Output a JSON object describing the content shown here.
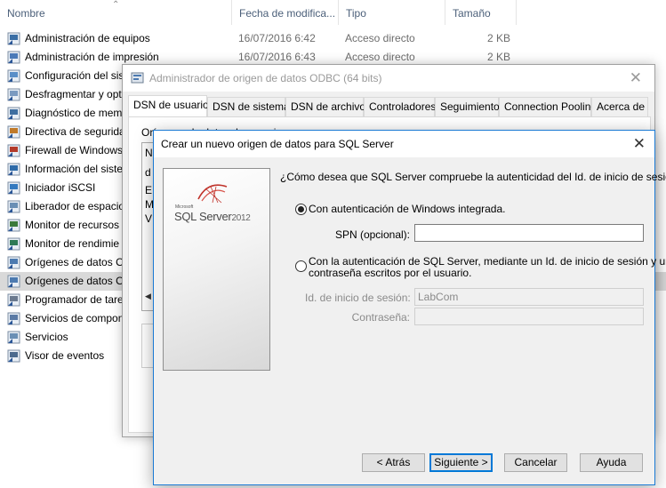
{
  "explorer": {
    "columns": {
      "name": "Nombre",
      "date": "Fecha de modifica...",
      "type": "Tipo",
      "size": "Tamaño"
    },
    "rows": [
      {
        "name": "Administración de equipos",
        "date": "16/07/2016 6:42",
        "type": "Acceso directo",
        "size": "2 KB"
      },
      {
        "name": "Administración de impresión",
        "date": "16/07/2016 6:43",
        "type": "Acceso directo",
        "size": "2 KB"
      },
      {
        "name": "Configuración del sis"
      },
      {
        "name": "Desfragmentar y opti"
      },
      {
        "name": "Diagnóstico de mem"
      },
      {
        "name": "Directiva de segurida"
      },
      {
        "name": "Firewall de Windows"
      },
      {
        "name": "Información del siste"
      },
      {
        "name": "Iniciador iSCSI"
      },
      {
        "name": "Liberador de espacio"
      },
      {
        "name": "Monitor de recursos"
      },
      {
        "name": "Monitor de rendimie"
      },
      {
        "name": "Orígenes de datos OD"
      },
      {
        "name": "Orígenes de datos OD"
      },
      {
        "name": "Programador de tare"
      },
      {
        "name": "Servicios de compon"
      },
      {
        "name": "Servicios"
      },
      {
        "name": "Visor de eventos"
      }
    ]
  },
  "odbc": {
    "title": "Administrador de origen de datos ODBC (64 bits)",
    "tabs": [
      "DSN de usuario",
      "DSN de sistema",
      "DSN de archivo",
      "Controladores",
      "Seguimiento",
      "Connection Pooling",
      "Acerca de"
    ],
    "pane_label": "Orígenes de datos de usuario:",
    "list_letters": [
      "N",
      "d",
      "E",
      "M",
      "V"
    ]
  },
  "wizard": {
    "title": "Crear un nuevo origen de datos para SQL Server",
    "logo_small": "Microsoft",
    "logo_main": "SQL Server",
    "logo_year": "2012",
    "question": "¿Cómo desea que SQL Server compruebe la autenticidad del Id. de inicio de sesión?",
    "option_windows": "Con autenticación de Windows integrada.",
    "spn_label": "SPN (opcional):",
    "spn_value": "",
    "option_sql_line1": "Con la autenticación de SQL Server, mediante un Id. de inicio de sesión y una",
    "option_sql_line2": "contraseña escritos por el usuario.",
    "login_label": "Id. de inicio de sesión:",
    "login_value": "LabCom",
    "password_label": "Contraseña:",
    "password_value": "",
    "buttons": {
      "back": "< Atrás",
      "next": "Siguiente >",
      "cancel": "Cancelar",
      "help": "Ayuda"
    }
  },
  "colors": {
    "accent": "#0078d7",
    "selected_row": "#d9d9d9",
    "header_text": "#4c607a"
  }
}
